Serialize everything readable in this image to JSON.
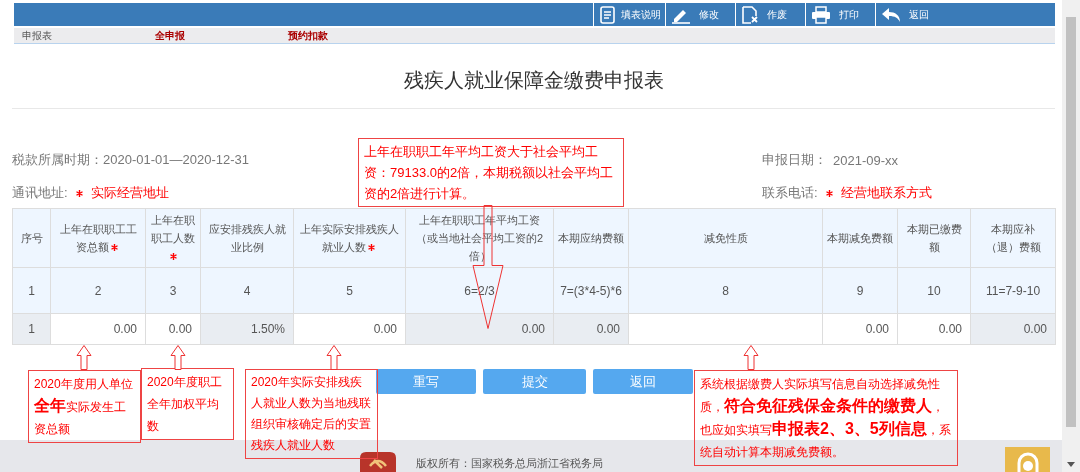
{
  "toolbar": [
    {
      "label": "填表说明"
    },
    {
      "label": "修改"
    },
    {
      "label": "作废"
    },
    {
      "label": "打印"
    },
    {
      "label": "返回"
    }
  ],
  "subtabs": [
    {
      "label": "申报表",
      "kind": "plain"
    },
    {
      "label": "全申报",
      "kind": "link"
    },
    {
      "label": "预约扣款",
      "kind": "link"
    }
  ],
  "title": "残疾人就业保障金缴费申报表",
  "period": "税款所属时期：2020-01-01—2020-12-31",
  "declare_date": {
    "label": "申报日期：",
    "value": "2021-09-xx"
  },
  "address": {
    "label": "通讯地址:",
    "required": true,
    "value": "实际经营地址"
  },
  "phone": {
    "label": "联系电话:",
    "required": true,
    "value": "经营地联系方式"
  },
  "table": {
    "columns": [
      {
        "label": "序号",
        "required": false
      },
      {
        "label": "上年在职职工工资总额",
        "required": true
      },
      {
        "label": "上年在职职工人数",
        "required": true
      },
      {
        "label": "应安排残疾人就业比例",
        "required": false
      },
      {
        "label": "上年实际安排残疾人就业人数",
        "required": true
      },
      {
        "label": "上年在职职工年平均工资（或当地社会平均工资的2倍）",
        "required": false
      },
      {
        "label": "本期应纳费额",
        "required": false
      },
      {
        "label": "减免性质",
        "required": false
      },
      {
        "label": "本期减免费额",
        "required": false
      },
      {
        "label": "本期已缴费额",
        "required": false
      },
      {
        "label": "本期应补（退）费额",
        "required": false
      }
    ],
    "number_row": [
      "1",
      "2",
      "3",
      "4",
      "5",
      "6=2/3",
      "7=(3*4-5)*6",
      "8",
      "9",
      "10",
      "11=7-9-10"
    ],
    "data_row": [
      {
        "value": "1",
        "editable": false
      },
      {
        "value": "0.00",
        "editable": true
      },
      {
        "value": "0.00",
        "editable": true
      },
      {
        "value": "1.50%",
        "editable": false
      },
      {
        "value": "0.00",
        "editable": true
      },
      {
        "value": "0.00",
        "editable": false
      },
      {
        "value": "0.00",
        "editable": false
      },
      {
        "editable": true
      },
      {
        "value": "0.00",
        "editable": true
      },
      {
        "value": "0.00",
        "editable": true
      },
      {
        "value": "0.00",
        "editable": false
      }
    ]
  },
  "buttons": [
    "重写",
    "提交",
    "返回"
  ],
  "annotations": [
    {
      "text": "上年在职职工年平均工资大于社会平均工资：79133.0的2倍，本期税额以社会平均工资的2倍进行计算。"
    },
    {
      "text": "2020年度用人单位**全年**实际发生工资总额"
    },
    {
      "text": "2020年度职工全年加权平均数"
    },
    {
      "text": "2020年实际安排残疾人就业人数为当地残联组织审核确定后的安置残疾人就业人数"
    },
    {
      "text": "系统根据缴费人实际填写信息自动选择减免性质，**符合免征残保金条件的缴费人**，也应如实填写**申报表2、3、5列信息**，系统自动计算本期减免费额。"
    }
  ],
  "footer": {
    "copyright": "版权所有：国家税务总局浙江省税务局"
  }
}
